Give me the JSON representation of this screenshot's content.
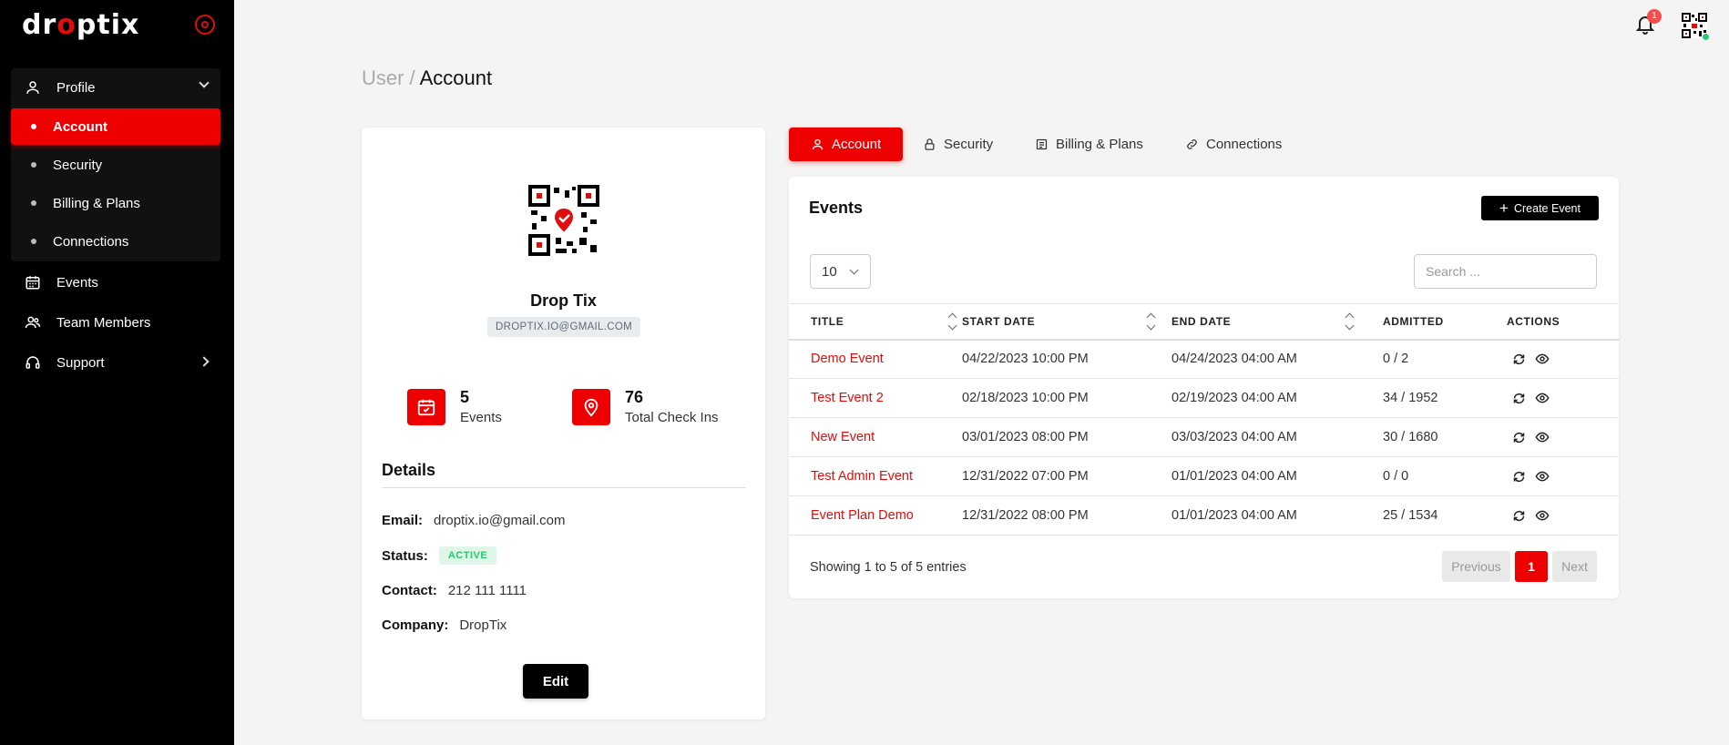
{
  "app": {
    "logo_text_start": "dr",
    "logo_dot": "o",
    "logo_text_end": "ptix",
    "notification_count": "1"
  },
  "sidebar": {
    "items": [
      {
        "label": "Profile",
        "icon": "user-icon"
      },
      {
        "label": "Events",
        "icon": "calendar-icon"
      },
      {
        "label": "Team Members",
        "icon": "users-icon"
      },
      {
        "label": "Support",
        "icon": "headset-icon"
      }
    ],
    "profile_sub": [
      {
        "label": "Account",
        "active": true
      },
      {
        "label": "Security",
        "active": false
      },
      {
        "label": "Billing & Plans",
        "active": false
      },
      {
        "label": "Connections",
        "active": false
      }
    ]
  },
  "breadcrumb": {
    "parent": "User /",
    "current": "Account"
  },
  "profile": {
    "name": "Drop Tix",
    "email_badge": "DROPTIX.IO@GMAIL.COM",
    "stats": [
      {
        "value": "5",
        "label": "Events",
        "icon": "calendar-check-icon"
      },
      {
        "value": "76",
        "label": "Total Check Ins",
        "icon": "map-pin-icon"
      }
    ],
    "details_title": "Details",
    "details": {
      "email_label": "Email:",
      "email": "droptix.io@gmail.com",
      "status_label": "Status:",
      "status": "ACTIVE",
      "contact_label": "Contact:",
      "contact": "212 111 1111",
      "company_label": "Company:",
      "company": "DropTix"
    },
    "edit_label": "Edit"
  },
  "tabs": [
    {
      "label": "Account",
      "icon": "user-icon",
      "active": true
    },
    {
      "label": "Security",
      "icon": "lock-icon",
      "active": false
    },
    {
      "label": "Billing & Plans",
      "icon": "document-icon",
      "active": false
    },
    {
      "label": "Connections",
      "icon": "link-icon",
      "active": false
    }
  ],
  "events": {
    "title": "Events",
    "create_label": "Create Event",
    "page_size": "10",
    "search_placeholder": "Search ...",
    "columns": [
      "TITLE",
      "START DATE",
      "END DATE",
      "ADMITTED",
      "ACTIONS"
    ],
    "rows": [
      {
        "title": "Demo Event",
        "start": "04/22/2023 10:00 PM",
        "end": "04/24/2023 04:00 AM",
        "admitted": "0 / 2"
      },
      {
        "title": "Test Event 2",
        "start": "02/18/2023 10:00 PM",
        "end": "02/19/2023 04:00 AM",
        "admitted": "34 / 1952"
      },
      {
        "title": "New Event",
        "start": "03/01/2023 08:00 PM",
        "end": "03/03/2023 04:00 AM",
        "admitted": "30 / 1680"
      },
      {
        "title": "Test Admin Event",
        "start": "12/31/2022 07:00 PM",
        "end": "01/01/2023 04:00 AM",
        "admitted": "0 / 0"
      },
      {
        "title": "Event Plan Demo",
        "start": "12/31/2022 08:00 PM",
        "end": "01/01/2023 04:00 AM",
        "admitted": "25 / 1534"
      }
    ],
    "showing": "Showing 1 to 5 of 5 entries",
    "pagination": {
      "prev": "Previous",
      "current": "1",
      "next": "Next"
    }
  },
  "colors": {
    "accent": "#ee0000",
    "sidebar_bg": "#000000",
    "status_green": "#28c76f"
  }
}
